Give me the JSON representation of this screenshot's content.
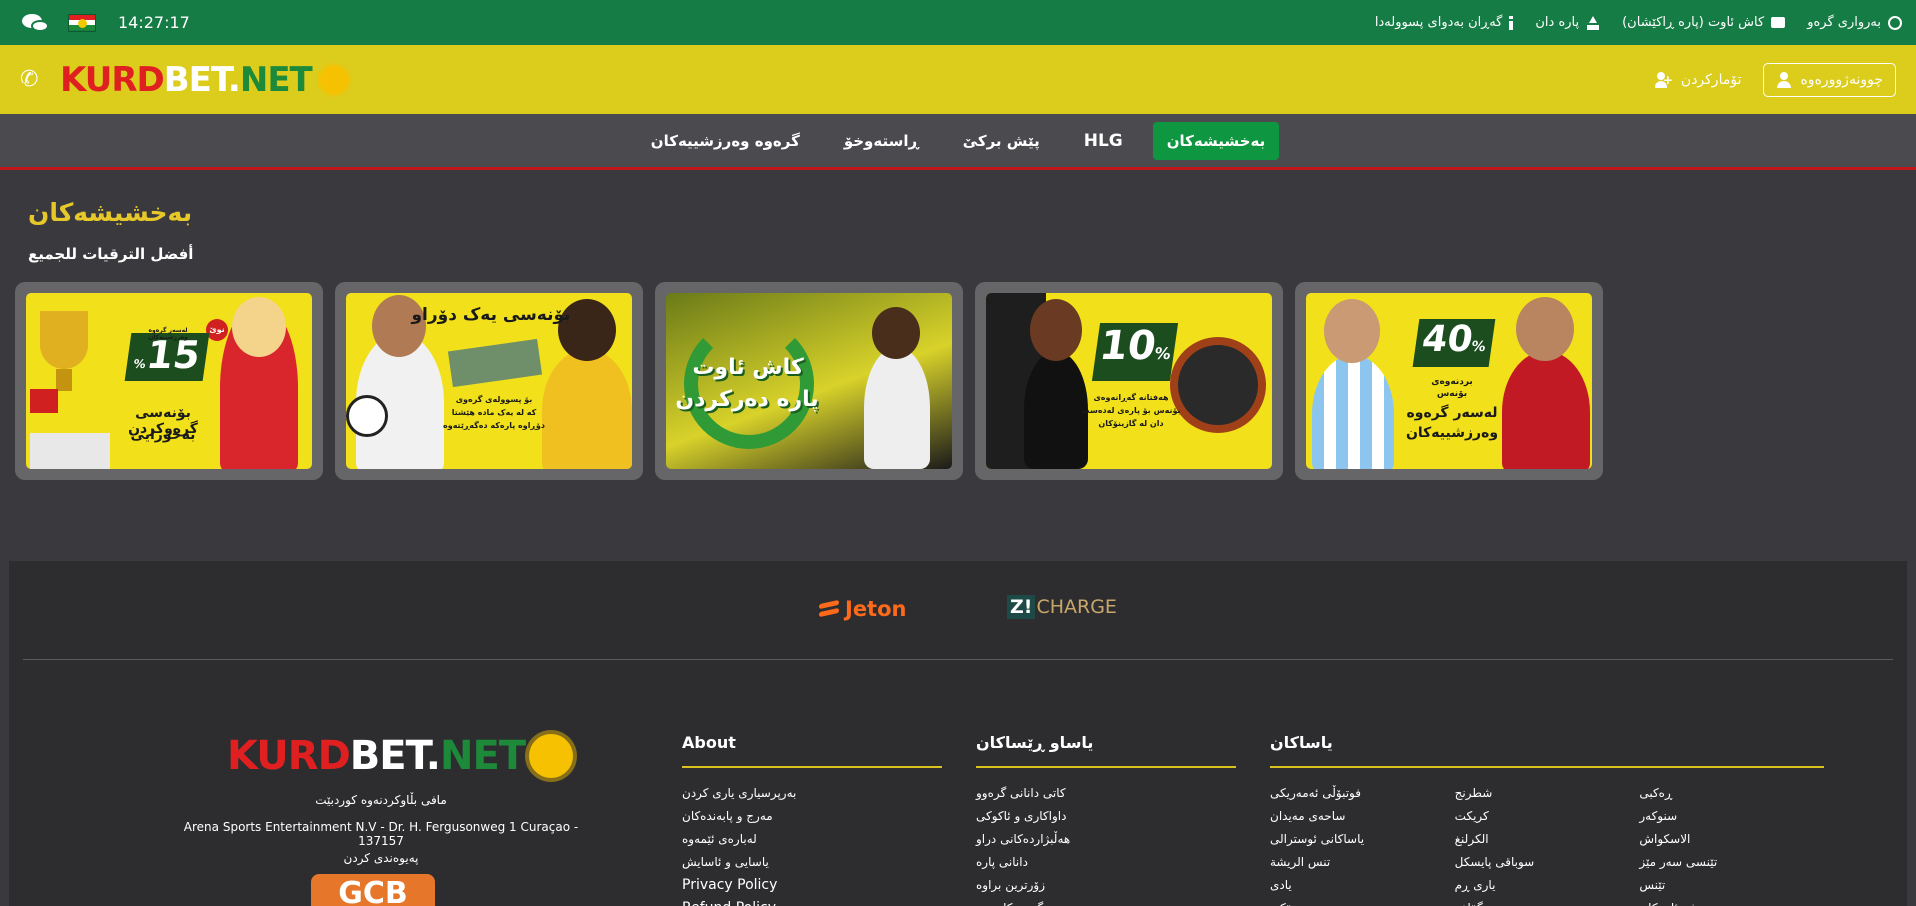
{
  "topbar": {
    "clock": "14:27:17",
    "links": [
      {
        "label": "بەرواری گرەو",
        "icon": "history-icon"
      },
      {
        "label": "کاش ئاوت (پارە ڕاکێشان)",
        "icon": "cash-register-icon"
      },
      {
        "label": "پارە دان",
        "icon": "upload-icon"
      },
      {
        "label": "گەڕان بەدوای پسوولەدا",
        "icon": "info-icon"
      }
    ]
  },
  "header": {
    "logo": {
      "k": "KURD",
      "b": "BET.",
      "n": "NET"
    },
    "register_label": "تۆمارکردن",
    "login_label": "چوونەژوورەوە"
  },
  "nav": {
    "items": [
      {
        "label": "بەخشیشەکان",
        "active": true
      },
      {
        "label": "HLG",
        "active": false
      },
      {
        "label": "پێش برکێ",
        "active": false
      },
      {
        "label": "ڕاستەوخۆ",
        "active": false
      },
      {
        "label": "گرەوە وەرزشییەکان",
        "active": false
      }
    ]
  },
  "page": {
    "title": "بەخشیشەکان",
    "subtitle": "أفضل الترقيات للجميع"
  },
  "cards": [
    {
      "pct": "15",
      "line1": "بۆنەسی گرەوکردن",
      "line2": "بەخۆرایی",
      "tag": "نوێ",
      "small": "لەسەر گرەوە وەرزشییەکان"
    },
    {
      "headline": "بۆنەسی یەک دۆراو",
      "line1": "بۆ پسوولەی گرەوی",
      "line2": "کە لە یەک مادە هێشتا",
      "line3": "دۆڕاوە پارەکە دەگەڕێتەوە"
    },
    {
      "line1": "کاش ئاوت",
      "line2": "پارە دەرکردن"
    },
    {
      "pct": "10",
      "line1": "هەفتانە گەڕانەوەی",
      "line2": "بۆنەس بۆ پارەی لەدەست",
      "line3": "دان لە گازینۆکان"
    },
    {
      "pct": "40",
      "line1": "بردنەوەی",
      "line2": "بۆنەس",
      "line3": "لەسەر گرەوە",
      "line4": "وەرزشییەکان"
    }
  ],
  "footer": {
    "payments": {
      "jeton": "Jeton",
      "zcharge_z": "Z!",
      "zcharge_rest": "CHARGE"
    },
    "logo": {
      "k": "KURD",
      "b": "BET.",
      "n": "NET"
    },
    "owner": "مافی بڵاوکردنەوە کوردبێت",
    "company": "Arena Sports Entertainment N.V - Dr. H. Fergusonweg 1 Curaçao - 137157",
    "contact": "پەیوەندی کردن",
    "gcb": "GCB",
    "about": {
      "title": "About",
      "items": [
        "بەرپرسیاری یاری کردن",
        "مەرج و پابەندەکان",
        "لەبارەی ئێمەوە",
        "یاسایی و ئاسایش",
        "Privacy Policy",
        "Refund Policy"
      ]
    },
    "rules": {
      "title": "یاساو ڕێساکان",
      "items": [
        "کاتی دانانی گرەوو",
        "داواکاری و ئاکوکی",
        "هەڵبژاردەکانی دراو",
        "دانانی پارە",
        "زۆرترین براوە",
        "گرەوەکانی تر"
      ]
    },
    "sports": {
      "title": "یاساکان",
      "col1": [
        "فوتبۆڵی ئەمەریکی",
        "ساحەی مەیدان",
        "یاساکانی ئوسترالی",
        "تنس الريشة",
        "یادی",
        "هۆکی"
      ],
      "col2": [
        "شطرنج",
        "کریکت",
        "الكرلنغ",
        "سوباقی پایسکل",
        "یاری ڕم",
        "گۆلف"
      ],
      "col3": [
        "ڕەکبی",
        "سنوکەر",
        "الاسکواش",
        "تێنسی سەر مێز",
        "تێنس",
        "وەرزشە ئاییەکان"
      ]
    }
  }
}
